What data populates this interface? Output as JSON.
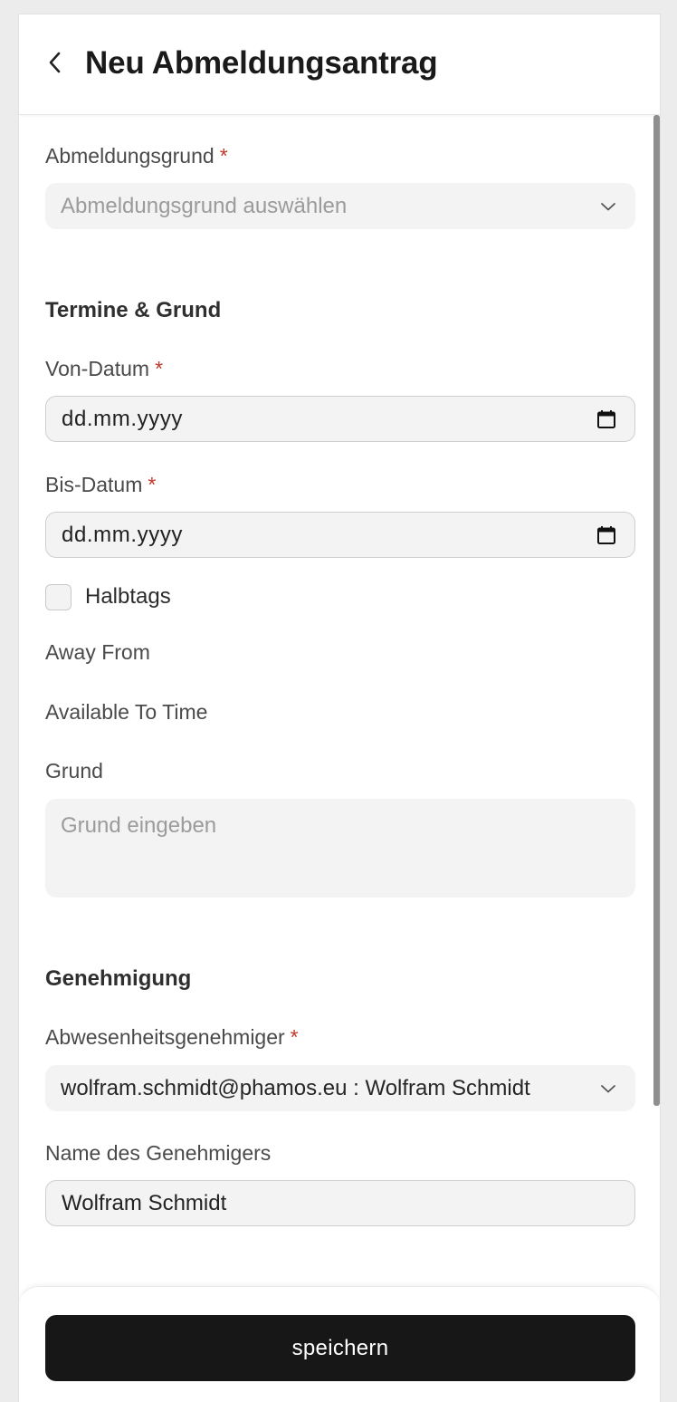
{
  "header": {
    "title": "Neu Abmeldungsantrag"
  },
  "form": {
    "reason_type": {
      "label": "Abmeldungsgrund",
      "required_mark": "*",
      "placeholder": "Abmeldungsgrund auswählen"
    },
    "dates_section_title": "Termine & Grund",
    "from_date": {
      "label": "Von-Datum",
      "required_mark": "*",
      "value": "dd.mm.yyyy"
    },
    "to_date": {
      "label": "Bis-Datum",
      "required_mark": "*",
      "value": "dd.mm.yyyy"
    },
    "half_day": {
      "label": "Halbtags",
      "checked": false
    },
    "away_from_label": "Away From",
    "available_to_time_label": "Available To Time",
    "reason": {
      "label": "Grund",
      "placeholder": "Grund eingeben"
    },
    "approval_section_title": "Genehmigung",
    "approver": {
      "label": "Abwesenheitsgenehmiger",
      "required_mark": "*",
      "value": "wolfram.schmidt@phamos.eu : Wolfram Schmidt"
    },
    "approver_name": {
      "label": "Name des Genehmigers",
      "value": "Wolfram Schmidt"
    }
  },
  "footer": {
    "save_label": "speichern"
  },
  "colors": {
    "required": "#c0392b",
    "primary_button": "#171717",
    "input_background": "#f3f3f3"
  }
}
